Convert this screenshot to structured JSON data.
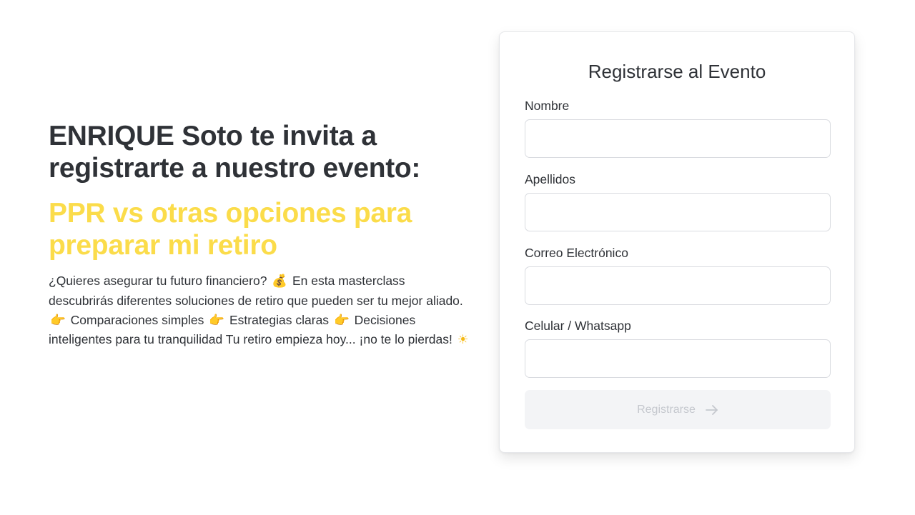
{
  "intro": {
    "host_heading": "ENRIQUE Soto te invita a registrarte a nuestro evento:",
    "event_title": "PPR vs otras opciones para preparar mi retiro",
    "description": {
      "part1": "¿Quieres asegurar tu futuro financiero?",
      "part2": "En esta masterclass descubrirás diferentes soluciones de retiro que pueden ser tu mejor aliado.",
      "part3": "Comparaciones simples",
      "part4": "Estrategias claras",
      "part5": "Decisiones inteligentes para tu tranquilidad Tu retiro empieza hoy... ¡no te lo pierdas!",
      "emoji_money": "💰",
      "emoji_point": "👉",
      "emoji_sun": "☀"
    }
  },
  "form": {
    "title": "Registrarse al Evento",
    "fields": [
      {
        "label": "Nombre",
        "value": "",
        "placeholder": ""
      },
      {
        "label": "Apellidos",
        "value": "",
        "placeholder": ""
      },
      {
        "label": "Correo Electrónico",
        "value": "",
        "placeholder": ""
      },
      {
        "label": "Celular / Whatsapp",
        "value": "",
        "placeholder": ""
      }
    ],
    "submit_label": "Registrarse",
    "submit_icon": "arrow-right-icon"
  },
  "colors": {
    "accent_yellow": "#fbdc4a",
    "text_dark": "#2f3237",
    "button_disabled_bg": "#f3f4f6",
    "button_disabled_text": "#c5c8ce"
  }
}
